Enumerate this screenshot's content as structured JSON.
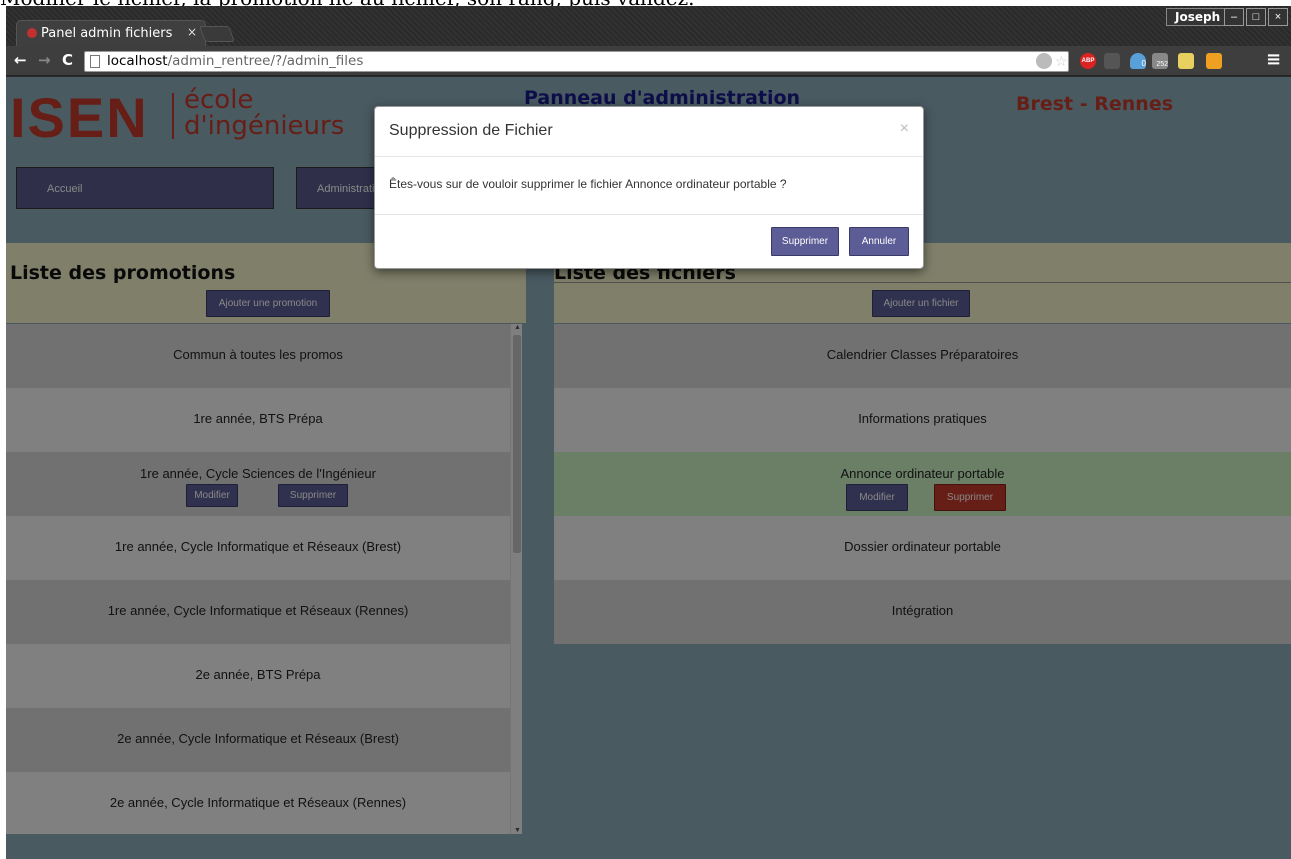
{
  "instruction_text": "Modifier le fichier, la promotion lié au fichier, son rang, puis validez.",
  "browser": {
    "tab_title": "Panel admin fichiers",
    "tab_close": "×",
    "user_name": "Joseph",
    "window_buttons": [
      "–",
      "□",
      "×"
    ],
    "url_host": "localhost",
    "url_path": "/admin_rentree/?/admin_files",
    "nav": {
      "back": "←",
      "forward": "→",
      "reload": "C"
    },
    "menu_icon": "≡",
    "extension_badges": {
      "abp": "ABP",
      "ghost_count": "0",
      "rss_count": "252"
    }
  },
  "header": {
    "logo_main": "ISEN",
    "logo_sub_line1": "école",
    "logo_sub_line2": "d'ingénieurs",
    "page_heading": "Panneau d'administration",
    "campus": "Brest - Rennes"
  },
  "nav": {
    "items": [
      "Accueil",
      "Administration"
    ]
  },
  "promotions": {
    "title": "Liste des promotions",
    "add_button": "Ajouter une promotion",
    "rows": [
      "Commun à toutes les promos",
      "1re année, BTS Prépa",
      "1re année, Cycle Sciences de l'Ingénieur",
      "1re année, Cycle Informatique et Réseaux (Brest)",
      "1re année, Cycle Informatique et Réseaux (Rennes)",
      "2e année, BTS Prépa",
      "2e année, Cycle Informatique et Réseaux (Brest)",
      "2e année, Cycle Informatique et Réseaux (Rennes)"
    ],
    "row_edit": "Modifier",
    "row_delete": "Supprimer"
  },
  "files": {
    "title": "Liste des fichiers",
    "add_button": "Ajouter un fichier",
    "rows": [
      "Calendrier Classes Préparatoires",
      "Informations pratiques",
      "Annonce ordinateur portable",
      "Dossier ordinateur portable",
      "Intégration"
    ],
    "row_edit": "Modifier",
    "row_delete": "Supprimer"
  },
  "modal": {
    "title": "Suppression de Fichier",
    "close": "×",
    "message": "Êtes-vous sur de vouloir supprimer le fichier Annonce ordinateur portable ?",
    "confirm_button": "Supprimer",
    "cancel_button": "Annuler"
  },
  "colors": {
    "brand_red": "#c0392b",
    "button_purple": "#5c5c96",
    "selected_row": "#c9f0c0",
    "page_bg": "#8aaab8"
  }
}
